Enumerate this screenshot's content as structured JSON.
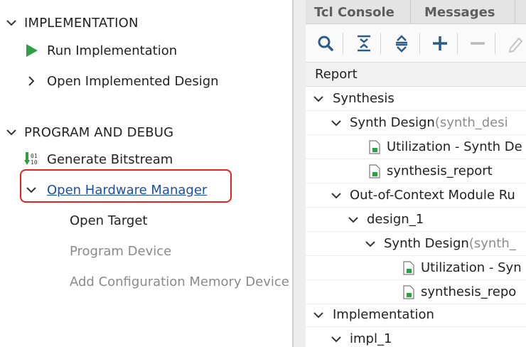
{
  "flow_navigator": {
    "implementation": {
      "title": "IMPLEMENTATION",
      "run_implementation": "Run Implementation",
      "open_implemented_design": "Open Implemented Design"
    },
    "program_debug": {
      "title": "PROGRAM AND DEBUG",
      "generate_bitstream": "Generate Bitstream",
      "open_hardware_manager": "Open Hardware Manager",
      "open_target": "Open Target",
      "program_device": "Program Device",
      "add_config_memory": "Add Configuration Memory Device"
    },
    "colors": {
      "run_icon": "#2ea043",
      "link": "#1a4fa8",
      "highlight": "#e3231f"
    }
  },
  "tabs": [
    {
      "label": "Tcl Console"
    },
    {
      "label": "Messages"
    }
  ],
  "toolbar": {
    "icons": [
      "search-icon",
      "collapse-all-icon",
      "expand-all-icon",
      "add-icon",
      "remove-icon",
      "edit-icon"
    ]
  },
  "report_panel": {
    "header": "Report",
    "rows": [
      {
        "label": "Synthesis",
        "suffix": ""
      },
      {
        "label": "Synth Design",
        "suffix": " (synth_desi"
      },
      {
        "label": "Utilization - Synth De",
        "suffix": ""
      },
      {
        "label": "synthesis_report",
        "suffix": ""
      },
      {
        "label": "Out-of-Context Module Ru",
        "suffix": ""
      },
      {
        "label": "design_1",
        "suffix": ""
      },
      {
        "label": "Synth Design",
        "suffix": " (synth_"
      },
      {
        "label": "Utilization - Syn",
        "suffix": ""
      },
      {
        "label": "synthesis_repo",
        "suffix": ""
      },
      {
        "label": "Implementation",
        "suffix": ""
      },
      {
        "label": "impl_1",
        "suffix": ""
      }
    ]
  }
}
